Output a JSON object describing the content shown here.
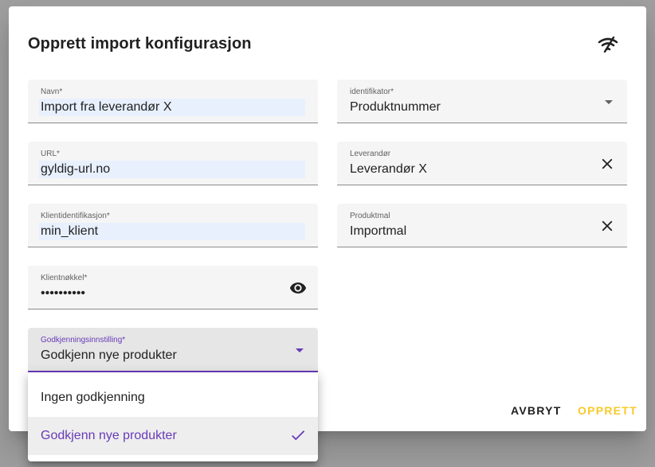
{
  "dialog": {
    "title": "Opprett import konfigurasjon",
    "title_icon": "signal-cellular-off-icon"
  },
  "fields": {
    "navn": {
      "label": "Navn*",
      "value": "Import fra leverandør X"
    },
    "url": {
      "label": "URL*",
      "value": "gyldig-url.no"
    },
    "klientid": {
      "label": "Klientidentifikasjon*",
      "value": "min_klient"
    },
    "klientnokkel": {
      "label": "Klientnøkkel*",
      "value": "••••••••••",
      "trailing_icon": "eye-icon"
    },
    "godkjenning": {
      "label": "Godkjenningsinnstilling*",
      "value": "Godkjenn nye produkter"
    },
    "identifikator": {
      "label": "identifikator*",
      "value": "Produktnummer"
    },
    "leverandor": {
      "label": "Leverandør",
      "value": "Leverandør X",
      "trailing_icon": "close-icon"
    },
    "produktmal": {
      "label": "Produktmal",
      "value": "Importmal",
      "trailing_icon": "close-icon"
    }
  },
  "menu": {
    "options": [
      {
        "label": "Ingen godkjenning",
        "selected": false
      },
      {
        "label": "Godkjenn nye produkter",
        "selected": true
      }
    ]
  },
  "actions": {
    "cancel": "AVBRYT",
    "create": "OPPRETT"
  },
  "colors": {
    "accent": "#673ab7",
    "create": "#f9c92b",
    "field_bg": "#f5f5f5",
    "autofill_bg": "#e8f0fe",
    "backdrop": "#9e9e9e"
  }
}
